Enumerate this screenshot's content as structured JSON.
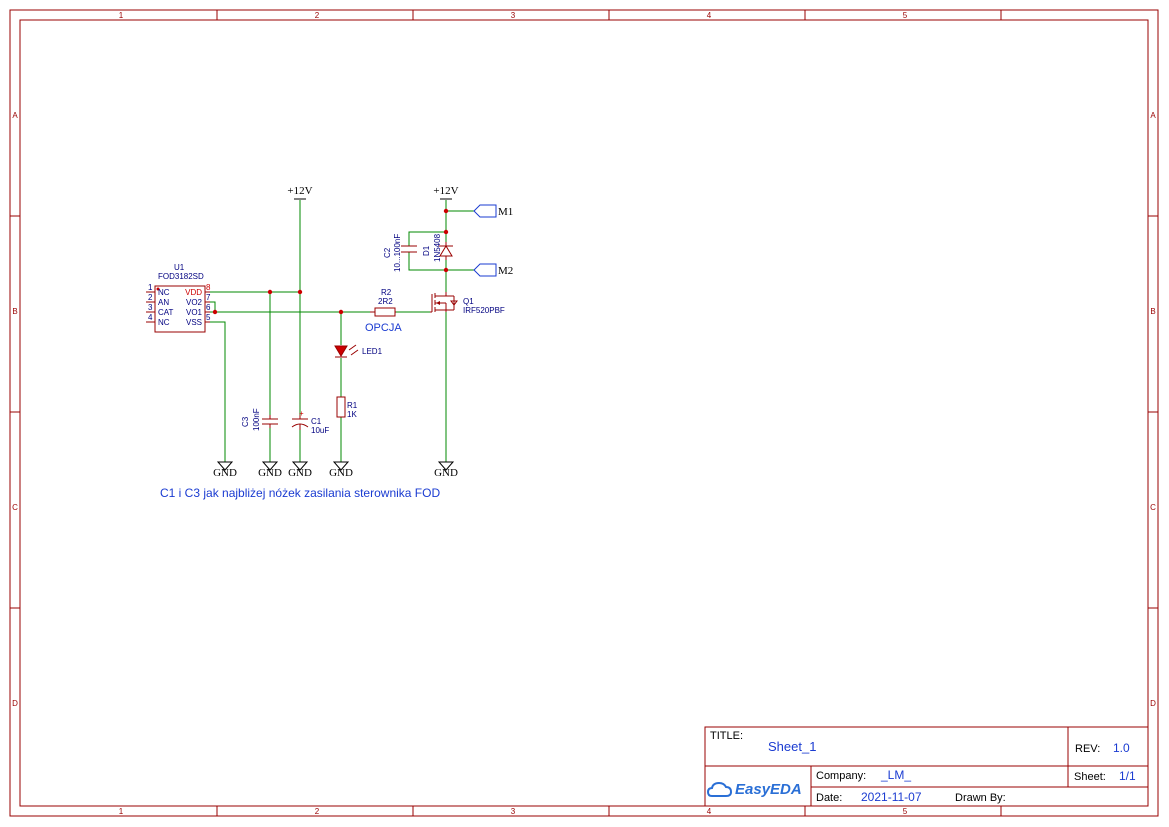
{
  "zones": {
    "columns": [
      "1",
      "2",
      "3",
      "4",
      "5"
    ],
    "rows": [
      "A",
      "B",
      "C",
      "D"
    ]
  },
  "nets": {
    "vcc_left": "+12V",
    "vcc_right": "+12V",
    "gnd": "GND",
    "port_m1": "M1",
    "port_m2": "M2"
  },
  "u1": {
    "designator": "U1",
    "value": "FOD3182SD",
    "pins_left": [
      {
        "num": "1",
        "name": "NC"
      },
      {
        "num": "2",
        "name": "AN"
      },
      {
        "num": "3",
        "name": "CAT"
      },
      {
        "num": "4",
        "name": "NC"
      }
    ],
    "pins_right": [
      {
        "num": "8",
        "name": "VDD"
      },
      {
        "num": "7",
        "name": "VO2"
      },
      {
        "num": "6",
        "name": "VO1"
      },
      {
        "num": "5",
        "name": "VSS"
      }
    ]
  },
  "c1": {
    "designator": "C1",
    "value": "10uF"
  },
  "c2": {
    "designator": "C2",
    "value": "10...100nF"
  },
  "c3": {
    "designator": "C3",
    "value": "100nF"
  },
  "d1": {
    "designator": "D1",
    "value": "1N5408"
  },
  "r1": {
    "designator": "R1",
    "value": "1K"
  },
  "r2": {
    "designator": "R2",
    "value": "2R2"
  },
  "led1": {
    "designator": "LED1"
  },
  "q1": {
    "designator": "Q1",
    "value": "IRF520PBF"
  },
  "notes": {
    "option": "OPCJA",
    "caption": "C1 i C3 jak najbliżej nóżek zasilania sterownika FOD"
  },
  "title_block": {
    "title_label": "TITLE:",
    "title_value": "Sheet_1",
    "rev_label": "REV:",
    "rev_value": "1.0",
    "company_label": "Company:",
    "company_value": "_LM_",
    "sheet_label": "Sheet:",
    "sheet_value": "1/1",
    "date_label": "Date:",
    "date_value": "2021-11-07",
    "drawn_label": "Drawn By:",
    "drawn_value": "",
    "logo_text": "EasyEDA"
  },
  "colors": {
    "frame": "#990000",
    "wire": "#008800",
    "junction": "#cc0000",
    "note": "#1a3bd1"
  }
}
